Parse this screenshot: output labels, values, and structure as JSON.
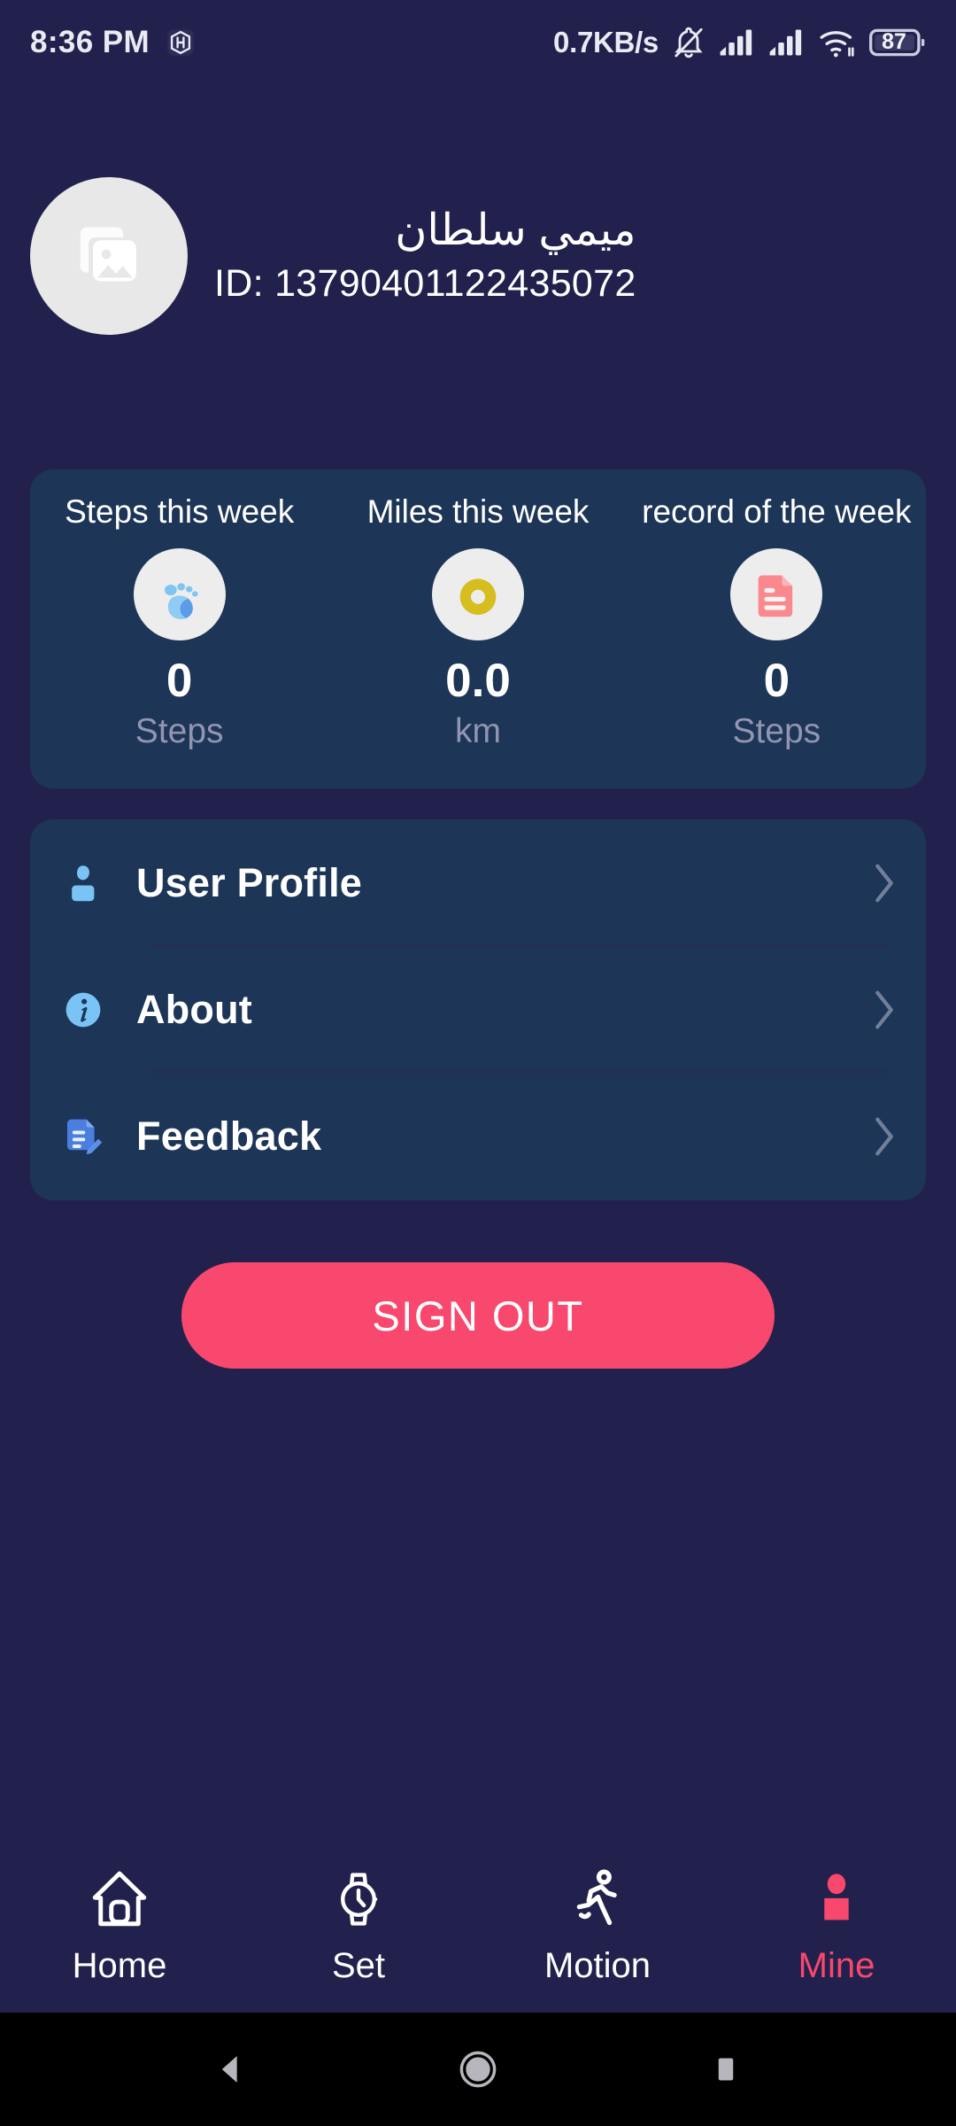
{
  "status_bar": {
    "time": "8:36 PM",
    "app_badge_icon": "hexagon-h-icon",
    "network_speed": "0.7KB/s",
    "silent_icon": "bell-muted-icon",
    "signal_1_icon": "signal-bars-icon",
    "signal_2_icon": "signal-bars-icon",
    "wifi_icon": "wifi-icon",
    "battery_level": "87",
    "battery_icon": "battery-icon"
  },
  "profile": {
    "avatar_icon": "image-placeholder-icon",
    "name": "ميمي سلطان",
    "id": "ID: 13790401122435072"
  },
  "stats": {
    "items": [
      {
        "title": "Steps this week",
        "icon": "footprint-icon",
        "value": "0",
        "unit": "Steps"
      },
      {
        "title": "Miles this week",
        "icon": "ring-icon",
        "value": "0.0",
        "unit": "km"
      },
      {
        "title": "record of the week",
        "icon": "document-icon",
        "value": "0",
        "unit": "Steps"
      }
    ]
  },
  "menu": {
    "items": [
      {
        "label": "User Profile",
        "icon": "person-icon",
        "chevron": "chevron-right-icon"
      },
      {
        "label": "About",
        "icon": "info-circle-icon",
        "chevron": "chevron-right-icon"
      },
      {
        "label": "Feedback",
        "icon": "feedback-edit-icon",
        "chevron": "chevron-right-icon"
      }
    ]
  },
  "sign_out": {
    "label": "SIGN OUT"
  },
  "tab_bar": {
    "tabs": [
      {
        "label": "Home",
        "icon": "home-icon",
        "active": false
      },
      {
        "label": "Set",
        "icon": "watch-icon",
        "active": false
      },
      {
        "label": "Motion",
        "icon": "runner-icon",
        "active": false
      },
      {
        "label": "Mine",
        "icon": "person-icon",
        "active": true
      }
    ]
  },
  "android_nav": {
    "back_icon": "back-triangle-icon",
    "home_icon": "home-circle-icon",
    "recents_icon": "recents-square-icon"
  },
  "colors": {
    "page_background": "#22214D",
    "card_background": "#1D3557",
    "accent": "#F9486E",
    "avatar_background": "#E8E8E8",
    "muted_text": "#9195B0",
    "divider": "#2B2A5C"
  }
}
